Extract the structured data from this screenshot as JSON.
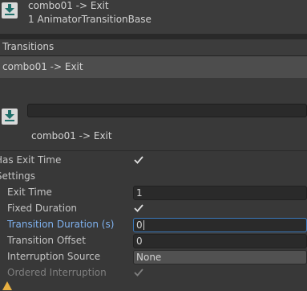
{
  "header": {
    "title": "combo01 -> Exit",
    "subtitle": "1 AnimatorTransitionBase",
    "icon": "transition-download-icon"
  },
  "transitions": {
    "header_label": "Transitions",
    "items": [
      "combo01 -> Exit"
    ]
  },
  "detail": {
    "name_value": "",
    "title": "combo01 -> Exit",
    "icon": "transition-download-icon"
  },
  "properties": {
    "has_exit_time": {
      "label": "Has Exit Time",
      "checked": true
    },
    "settings_label": "Settings",
    "exit_time": {
      "label": "Exit Time",
      "value": "1"
    },
    "fixed_duration": {
      "label": "Fixed Duration",
      "checked": true
    },
    "transition_duration": {
      "label": "Transition Duration (s)",
      "value": "0"
    },
    "transition_offset": {
      "label": "Transition Offset",
      "value": "0"
    },
    "interruption_source": {
      "label": "Interruption Source",
      "value": "None"
    },
    "ordered_interruption": {
      "label": "Ordered Interruption",
      "checked": true
    }
  },
  "colors": {
    "background": "#383838",
    "focus_label": "#7fb2f0",
    "focus_border": "#3a79bb",
    "warning": "#e8b040"
  }
}
